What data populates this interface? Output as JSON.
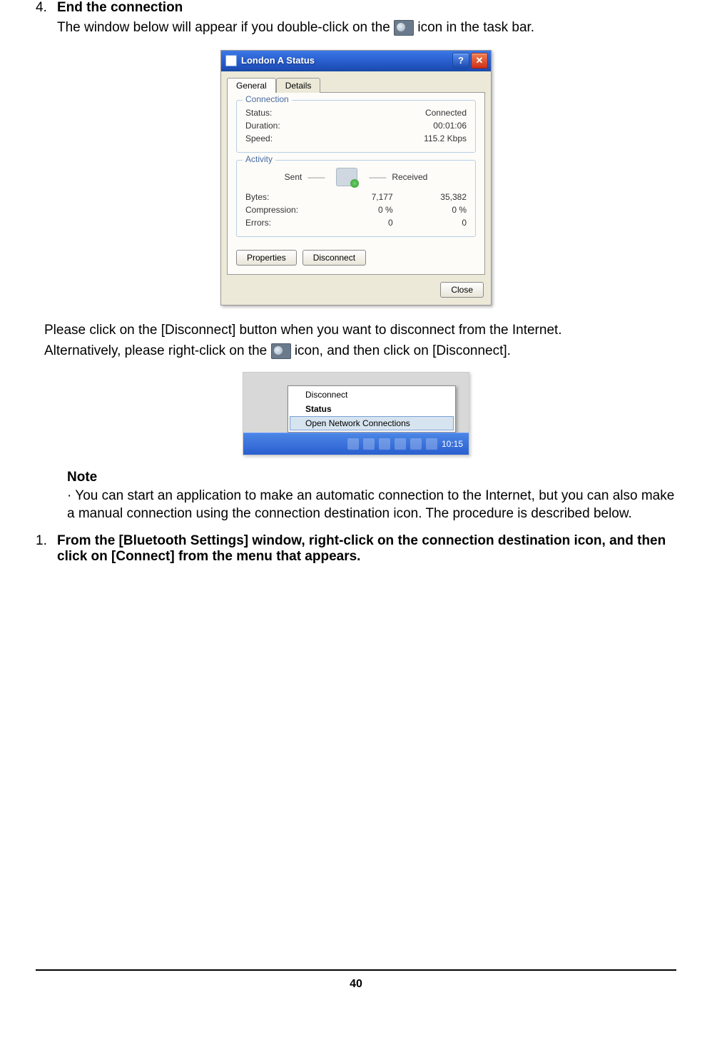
{
  "step4": {
    "number": "4.",
    "title": "End the connection",
    "line1a": "The window below will appear if you double-click on the",
    "line1b": "icon in the task bar."
  },
  "dialog": {
    "title": "London A Status",
    "help_symbol": "?",
    "close_symbol": "✕",
    "tabs": {
      "general": "General",
      "details": "Details"
    },
    "connection": {
      "legend": "Connection",
      "status_label": "Status:",
      "status_value": "Connected",
      "duration_label": "Duration:",
      "duration_value": "00:01:06",
      "speed_label": "Speed:",
      "speed_value": "115.2 Kbps"
    },
    "activity": {
      "legend": "Activity",
      "sent": "Sent",
      "received": "Received",
      "bytes_label": "Bytes:",
      "bytes_sent": "7,177",
      "bytes_received": "35,382",
      "compression_label": "Compression:",
      "compression_sent": "0 %",
      "compression_received": "0 %",
      "errors_label": "Errors:",
      "errors_sent": "0",
      "errors_received": "0"
    },
    "buttons": {
      "properties": "Properties",
      "disconnect": "Disconnect",
      "close": "Close"
    }
  },
  "after_dialog": {
    "p1": "Please click on the [Disconnect] button when you want to disconnect from the Internet.",
    "p2a": "Alternatively, please right-click on the",
    "p2b": "icon, and then click on [Disconnect]."
  },
  "context_menu": {
    "disconnect": "Disconnect",
    "status": "Status",
    "open_net": "Open Network Connections"
  },
  "taskbar_time": "10:15",
  "note": {
    "heading": "Note",
    "bullet": "·",
    "text": "You can start an application to make an automatic connection to the Internet, but you can also make a manual connection using the connection destination icon. The procedure is described below."
  },
  "step1": {
    "number": "1.",
    "text": "From the [Bluetooth Settings] window, right-click on the connection destination icon, and then click on [Connect] from the menu that appears"
  },
  "page_number": "40"
}
